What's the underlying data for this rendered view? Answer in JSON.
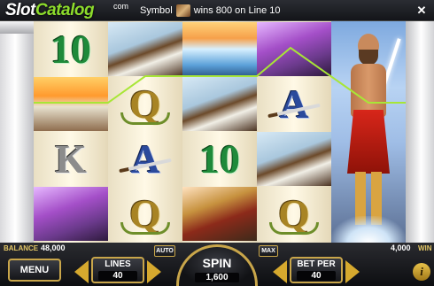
{
  "header": {
    "logo_slot": "Slot",
    "logo_catalog": "Catalog",
    "logo_com": "com",
    "message_prefix": "Symbol",
    "message_suffix": "wins 800 on Line 10",
    "close_glyph": "✕"
  },
  "reels": [
    [
      {
        "kind": "letter",
        "text": "10",
        "style": "sym-10",
        "win": false
      },
      {
        "kind": "pic",
        "style": "temple",
        "win": true
      },
      {
        "kind": "letter",
        "text": "K",
        "style": "sym-k",
        "win": false
      },
      {
        "kind": "pic",
        "style": "archer",
        "win": false
      }
    ],
    [
      {
        "kind": "pic",
        "style": "eagle",
        "win": true
      },
      {
        "kind": "letter",
        "text": "Q",
        "style": "sym-q",
        "win": false
      },
      {
        "kind": "letter",
        "text": "A",
        "style": "sym-a",
        "win": false
      },
      {
        "kind": "letter",
        "text": "Q",
        "style": "sym-q",
        "win": false
      }
    ],
    [
      {
        "kind": "pic",
        "style": "waterfall",
        "win": false
      },
      {
        "kind": "pic",
        "style": "eagle",
        "win": true
      },
      {
        "kind": "letter",
        "text": "10",
        "style": "sym-10",
        "win": false
      },
      {
        "kind": "pic",
        "style": "warrior",
        "win": false
      }
    ],
    [
      {
        "kind": "pic",
        "style": "archer",
        "win": true
      },
      {
        "kind": "letter",
        "text": "A",
        "style": "sym-a",
        "win": false
      },
      {
        "kind": "pic",
        "style": "eagle",
        "win": false
      },
      {
        "kind": "letter",
        "text": "Q",
        "style": "sym-q",
        "win": false
      }
    ]
  ],
  "win_line_color": "#a8e636",
  "accent_gold": "#c9a64a",
  "bottom": {
    "balance_label": "BALANCE",
    "balance_value": "48,000",
    "win_value": "4,000",
    "win_label": "WIN",
    "menu_label": "MENU",
    "lines_label": "LINES",
    "lines_value": "40",
    "auto_label": "AUTO",
    "spin_label": "SPIN",
    "spin_value": "1,600",
    "max_label": "MAX",
    "bet_per_label": "BET PER",
    "bet_per_value": "40",
    "info_glyph": "i"
  }
}
